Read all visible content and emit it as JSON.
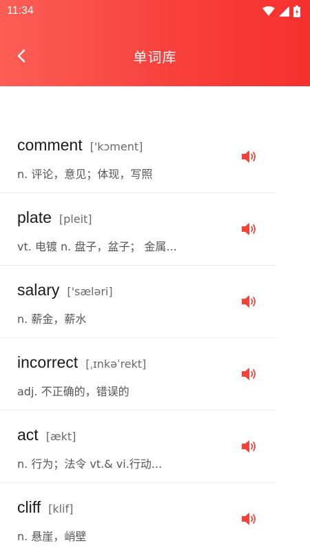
{
  "status_bar": {
    "time": "11:34"
  },
  "header": {
    "title": "单词库",
    "back_icon": "back-chevron-icon"
  },
  "colors": {
    "accent": "#f8413d",
    "speaker": "#f44336"
  },
  "words": [
    {
      "word": "comment",
      "phonetic": "['kɔment]",
      "meaning": "n. 评论，意见；体现，写照"
    },
    {
      "word": "plate",
      "phonetic": "[pleit]",
      "meaning": "vt. 电镀  n. 盘子，盆子；  金属..."
    },
    {
      "word": "salary",
      "phonetic": "['sæləri]",
      "meaning": "n. 薪金，薪水"
    },
    {
      "word": "incorrect",
      "phonetic": "[ˌɪnkəˈrekt]",
      "meaning": "adj. 不正确的，错误的"
    },
    {
      "word": "act",
      "phonetic": "[ækt]",
      "meaning": "n. 行为；法令  vt.& vi.行动..."
    },
    {
      "word": "cliff",
      "phonetic": "[klif]",
      "meaning": "n. 悬崖，峭壁"
    }
  ]
}
